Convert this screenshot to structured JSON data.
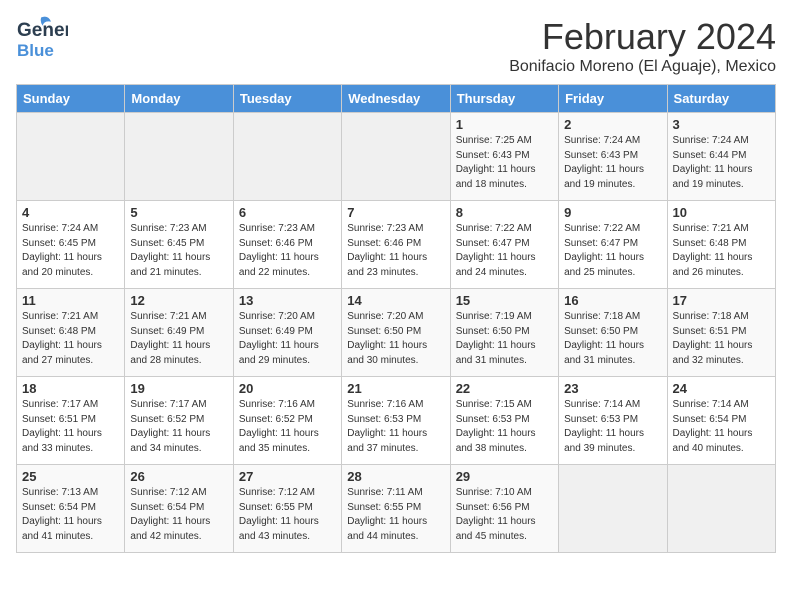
{
  "header": {
    "logo_line1": "General",
    "logo_line2": "Blue",
    "month_title": "February 2024",
    "location": "Bonifacio Moreno (El Aguaje), Mexico"
  },
  "weekdays": [
    "Sunday",
    "Monday",
    "Tuesday",
    "Wednesday",
    "Thursday",
    "Friday",
    "Saturday"
  ],
  "weeks": [
    [
      {
        "day": "",
        "info": ""
      },
      {
        "day": "",
        "info": ""
      },
      {
        "day": "",
        "info": ""
      },
      {
        "day": "",
        "info": ""
      },
      {
        "day": "1",
        "info": "Sunrise: 7:25 AM\nSunset: 6:43 PM\nDaylight: 11 hours\nand 18 minutes."
      },
      {
        "day": "2",
        "info": "Sunrise: 7:24 AM\nSunset: 6:43 PM\nDaylight: 11 hours\nand 19 minutes."
      },
      {
        "day": "3",
        "info": "Sunrise: 7:24 AM\nSunset: 6:44 PM\nDaylight: 11 hours\nand 19 minutes."
      }
    ],
    [
      {
        "day": "4",
        "info": "Sunrise: 7:24 AM\nSunset: 6:45 PM\nDaylight: 11 hours\nand 20 minutes."
      },
      {
        "day": "5",
        "info": "Sunrise: 7:23 AM\nSunset: 6:45 PM\nDaylight: 11 hours\nand 21 minutes."
      },
      {
        "day": "6",
        "info": "Sunrise: 7:23 AM\nSunset: 6:46 PM\nDaylight: 11 hours\nand 22 minutes."
      },
      {
        "day": "7",
        "info": "Sunrise: 7:23 AM\nSunset: 6:46 PM\nDaylight: 11 hours\nand 23 minutes."
      },
      {
        "day": "8",
        "info": "Sunrise: 7:22 AM\nSunset: 6:47 PM\nDaylight: 11 hours\nand 24 minutes."
      },
      {
        "day": "9",
        "info": "Sunrise: 7:22 AM\nSunset: 6:47 PM\nDaylight: 11 hours\nand 25 minutes."
      },
      {
        "day": "10",
        "info": "Sunrise: 7:21 AM\nSunset: 6:48 PM\nDaylight: 11 hours\nand 26 minutes."
      }
    ],
    [
      {
        "day": "11",
        "info": "Sunrise: 7:21 AM\nSunset: 6:48 PM\nDaylight: 11 hours\nand 27 minutes."
      },
      {
        "day": "12",
        "info": "Sunrise: 7:21 AM\nSunset: 6:49 PM\nDaylight: 11 hours\nand 28 minutes."
      },
      {
        "day": "13",
        "info": "Sunrise: 7:20 AM\nSunset: 6:49 PM\nDaylight: 11 hours\nand 29 minutes."
      },
      {
        "day": "14",
        "info": "Sunrise: 7:20 AM\nSunset: 6:50 PM\nDaylight: 11 hours\nand 30 minutes."
      },
      {
        "day": "15",
        "info": "Sunrise: 7:19 AM\nSunset: 6:50 PM\nDaylight: 11 hours\nand 31 minutes."
      },
      {
        "day": "16",
        "info": "Sunrise: 7:18 AM\nSunset: 6:50 PM\nDaylight: 11 hours\nand 31 minutes."
      },
      {
        "day": "17",
        "info": "Sunrise: 7:18 AM\nSunset: 6:51 PM\nDaylight: 11 hours\nand 32 minutes."
      }
    ],
    [
      {
        "day": "18",
        "info": "Sunrise: 7:17 AM\nSunset: 6:51 PM\nDaylight: 11 hours\nand 33 minutes."
      },
      {
        "day": "19",
        "info": "Sunrise: 7:17 AM\nSunset: 6:52 PM\nDaylight: 11 hours\nand 34 minutes."
      },
      {
        "day": "20",
        "info": "Sunrise: 7:16 AM\nSunset: 6:52 PM\nDaylight: 11 hours\nand 35 minutes."
      },
      {
        "day": "21",
        "info": "Sunrise: 7:16 AM\nSunset: 6:53 PM\nDaylight: 11 hours\nand 37 minutes."
      },
      {
        "day": "22",
        "info": "Sunrise: 7:15 AM\nSunset: 6:53 PM\nDaylight: 11 hours\nand 38 minutes."
      },
      {
        "day": "23",
        "info": "Sunrise: 7:14 AM\nSunset: 6:53 PM\nDaylight: 11 hours\nand 39 minutes."
      },
      {
        "day": "24",
        "info": "Sunrise: 7:14 AM\nSunset: 6:54 PM\nDaylight: 11 hours\nand 40 minutes."
      }
    ],
    [
      {
        "day": "25",
        "info": "Sunrise: 7:13 AM\nSunset: 6:54 PM\nDaylight: 11 hours\nand 41 minutes."
      },
      {
        "day": "26",
        "info": "Sunrise: 7:12 AM\nSunset: 6:54 PM\nDaylight: 11 hours\nand 42 minutes."
      },
      {
        "day": "27",
        "info": "Sunrise: 7:12 AM\nSunset: 6:55 PM\nDaylight: 11 hours\nand 43 minutes."
      },
      {
        "day": "28",
        "info": "Sunrise: 7:11 AM\nSunset: 6:55 PM\nDaylight: 11 hours\nand 44 minutes."
      },
      {
        "day": "29",
        "info": "Sunrise: 7:10 AM\nSunset: 6:56 PM\nDaylight: 11 hours\nand 45 minutes."
      },
      {
        "day": "",
        "info": ""
      },
      {
        "day": "",
        "info": ""
      }
    ]
  ]
}
